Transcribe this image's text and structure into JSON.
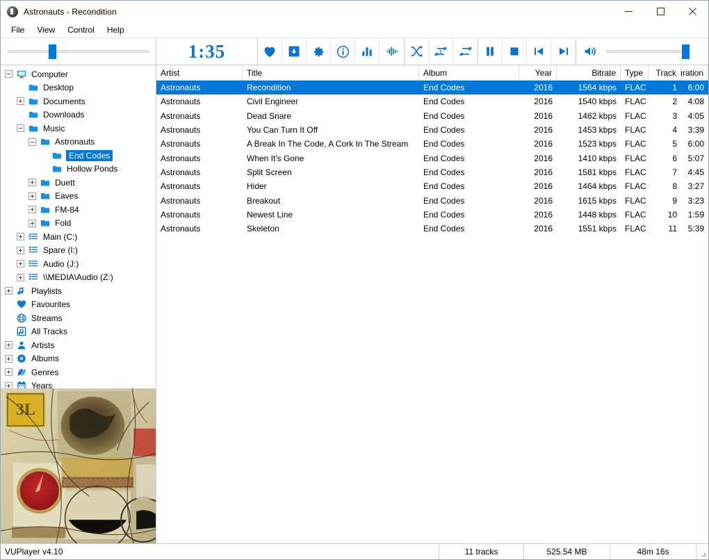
{
  "window": {
    "title": "Astronauts - Recondition",
    "icon": "speaker-icon",
    "minimize_label": "Minimize",
    "maximize_label": "Maximize",
    "close_label": "Close"
  },
  "menu": {
    "items": [
      {
        "label": "File"
      },
      {
        "label": "View"
      },
      {
        "label": "Control"
      },
      {
        "label": "Help"
      }
    ]
  },
  "toolbar": {
    "seek": {
      "name": "seek-slider",
      "position_percent": 30
    },
    "time_elapsed": "1:35",
    "buttons": [
      {
        "name": "favourites-button",
        "icon": "heart-icon"
      },
      {
        "name": "add-to-playlist-button",
        "icon": "save-box-icon"
      },
      {
        "name": "settings-button",
        "icon": "gear-icon"
      },
      {
        "name": "info-button",
        "icon": "info-circle-icon"
      },
      {
        "name": "eq-button",
        "icon": "bar-chart-icon"
      },
      {
        "name": "visualisation-button",
        "icon": "waveform-icon"
      },
      {
        "name": "shuffle-button",
        "icon": "shuffle-icon"
      },
      {
        "name": "repeat-one-button",
        "icon": "repeat-one-icon"
      },
      {
        "name": "repeat-all-button",
        "icon": "repeat-all-icon"
      },
      {
        "name": "pause-button",
        "icon": "pause-icon"
      },
      {
        "name": "stop-button",
        "icon": "stop-icon"
      },
      {
        "name": "previous-button",
        "icon": "skip-previous-icon"
      },
      {
        "name": "next-button",
        "icon": "skip-next-icon"
      }
    ],
    "volume": {
      "name": "volume-slider",
      "icon": "speaker-volume-icon",
      "position_percent": 100
    }
  },
  "sidebar": {
    "tree": [
      {
        "label": "Computer",
        "indent": 0,
        "expander": "minus",
        "icon": "computer-icon",
        "selected": false
      },
      {
        "label": "Desktop",
        "indent": 1,
        "expander": "none",
        "icon": "folder-icon",
        "selected": false
      },
      {
        "label": "Documents",
        "indent": 1,
        "expander": "plus",
        "icon": "folder-icon",
        "selected": false
      },
      {
        "label": "Downloads",
        "indent": 1,
        "expander": "none",
        "icon": "folder-icon",
        "selected": false
      },
      {
        "label": "Music",
        "indent": 1,
        "expander": "minus",
        "icon": "folder-icon",
        "selected": false
      },
      {
        "label": "Astronauts",
        "indent": 2,
        "expander": "minus",
        "icon": "folder-icon",
        "selected": false
      },
      {
        "label": "End Codes",
        "indent": 3,
        "expander": "none",
        "icon": "folder-icon",
        "selected": true
      },
      {
        "label": "Hollow Ponds",
        "indent": 3,
        "expander": "none",
        "icon": "folder-icon",
        "selected": false
      },
      {
        "label": "Duett",
        "indent": 2,
        "expander": "plus",
        "icon": "folder-icon",
        "selected": false
      },
      {
        "label": "Eaves",
        "indent": 2,
        "expander": "plus",
        "icon": "folder-icon",
        "selected": false
      },
      {
        "label": "FM-84",
        "indent": 2,
        "expander": "plus",
        "icon": "folder-icon",
        "selected": false
      },
      {
        "label": "Fold",
        "indent": 2,
        "expander": "plus",
        "icon": "folder-icon",
        "selected": false
      },
      {
        "label": "Main (C:)",
        "indent": 1,
        "expander": "plus",
        "icon": "drive-icon",
        "selected": false
      },
      {
        "label": "Spare (I:)",
        "indent": 1,
        "expander": "plus",
        "icon": "drive-icon",
        "selected": false
      },
      {
        "label": "Audio (J:)",
        "indent": 1,
        "expander": "plus",
        "icon": "drive-icon",
        "selected": false
      },
      {
        "label": "\\\\MEDIA\\Audio (Z:)",
        "indent": 1,
        "expander": "plus",
        "icon": "drive-icon",
        "selected": false
      },
      {
        "label": "Playlists",
        "indent": 0,
        "expander": "plus",
        "icon": "music-note-icon",
        "selected": false
      },
      {
        "label": "Favourites",
        "indent": 0,
        "expander": "none",
        "icon": "heart-icon",
        "selected": false
      },
      {
        "label": "Streams",
        "indent": 0,
        "expander": "none",
        "icon": "globe-icon",
        "selected": false
      },
      {
        "label": "All Tracks",
        "indent": 0,
        "expander": "none",
        "icon": "all-tracks-icon",
        "selected": false
      },
      {
        "label": "Artists",
        "indent": 0,
        "expander": "plus",
        "icon": "person-icon",
        "selected": false
      },
      {
        "label": "Albums",
        "indent": 0,
        "expander": "plus",
        "icon": "disc-icon",
        "selected": false
      },
      {
        "label": "Genres",
        "indent": 0,
        "expander": "plus",
        "icon": "genres-icon",
        "selected": false
      },
      {
        "label": "Years",
        "indent": 0,
        "expander": "plus",
        "icon": "calendar-icon",
        "selected": false
      }
    ],
    "album_art": {
      "name": "album-art",
      "description": "abstract collage artwork"
    }
  },
  "list": {
    "columns": [
      {
        "label": "Artist",
        "key": "artist",
        "align": "left"
      },
      {
        "label": "Title",
        "key": "title",
        "align": "left"
      },
      {
        "label": "Album",
        "key": "album",
        "align": "left"
      },
      {
        "label": "Year",
        "key": "year",
        "align": "right"
      },
      {
        "label": "Bitrate",
        "key": "bitrate",
        "align": "right"
      },
      {
        "label": "Type",
        "key": "type",
        "align": "left"
      },
      {
        "label": "Track",
        "key": "track",
        "align": "right"
      },
      {
        "label": "Duration",
        "key": "duration",
        "align": "right"
      }
    ],
    "rows": [
      {
        "artist": "Astronauts",
        "title": "Recondition",
        "album": "End Codes",
        "year": "2016",
        "bitrate": "1564 kbps",
        "type": "FLAC",
        "track": "1",
        "duration": "6:00",
        "selected": true
      },
      {
        "artist": "Astronauts",
        "title": "Civil Engineer",
        "album": "End Codes",
        "year": "2016",
        "bitrate": "1540 kbps",
        "type": "FLAC",
        "track": "2",
        "duration": "4:08",
        "selected": false
      },
      {
        "artist": "Astronauts",
        "title": "Dead Snare",
        "album": "End Codes",
        "year": "2016",
        "bitrate": "1462 kbps",
        "type": "FLAC",
        "track": "3",
        "duration": "4:05",
        "selected": false
      },
      {
        "artist": "Astronauts",
        "title": "You Can Turn It Off",
        "album": "End Codes",
        "year": "2016",
        "bitrate": "1453 kbps",
        "type": "FLAC",
        "track": "4",
        "duration": "3:39",
        "selected": false
      },
      {
        "artist": "Astronauts",
        "title": "A Break In The Code, A Cork In The Stream",
        "album": "End Codes",
        "year": "2016",
        "bitrate": "1523 kbps",
        "type": "FLAC",
        "track": "5",
        "duration": "6:00",
        "selected": false
      },
      {
        "artist": "Astronauts",
        "title": "When It's Gone",
        "album": "End Codes",
        "year": "2016",
        "bitrate": "1410 kbps",
        "type": "FLAC",
        "track": "6",
        "duration": "5:07",
        "selected": false
      },
      {
        "artist": "Astronauts",
        "title": "Split Screen",
        "album": "End Codes",
        "year": "2016",
        "bitrate": "1581 kbps",
        "type": "FLAC",
        "track": "7",
        "duration": "4:45",
        "selected": false
      },
      {
        "artist": "Astronauts",
        "title": "Hider",
        "album": "End Codes",
        "year": "2016",
        "bitrate": "1464 kbps",
        "type": "FLAC",
        "track": "8",
        "duration": "3:27",
        "selected": false
      },
      {
        "artist": "Astronauts",
        "title": "Breakout",
        "album": "End Codes",
        "year": "2016",
        "bitrate": "1615 kbps",
        "type": "FLAC",
        "track": "9",
        "duration": "3:23",
        "selected": false
      },
      {
        "artist": "Astronauts",
        "title": "Newest Line",
        "album": "End Codes",
        "year": "2016",
        "bitrate": "1448 kbps",
        "type": "FLAC",
        "track": "10",
        "duration": "1:59",
        "selected": false
      },
      {
        "artist": "Astronauts",
        "title": "Skeleton",
        "album": "End Codes",
        "year": "2016",
        "bitrate": "1551 kbps",
        "type": "FLAC",
        "track": "11",
        "duration": "5:39",
        "selected": false
      }
    ]
  },
  "status": {
    "app_version": "VUPlayer v4.10",
    "track_count": "11 tracks",
    "total_size": "525.54 MB",
    "total_duration": "48m 16s"
  },
  "colors": {
    "accent": "#0078d7",
    "icon_blue": "#0f74c8",
    "selection": "#0078d7",
    "time_blue": "#1173c4"
  }
}
